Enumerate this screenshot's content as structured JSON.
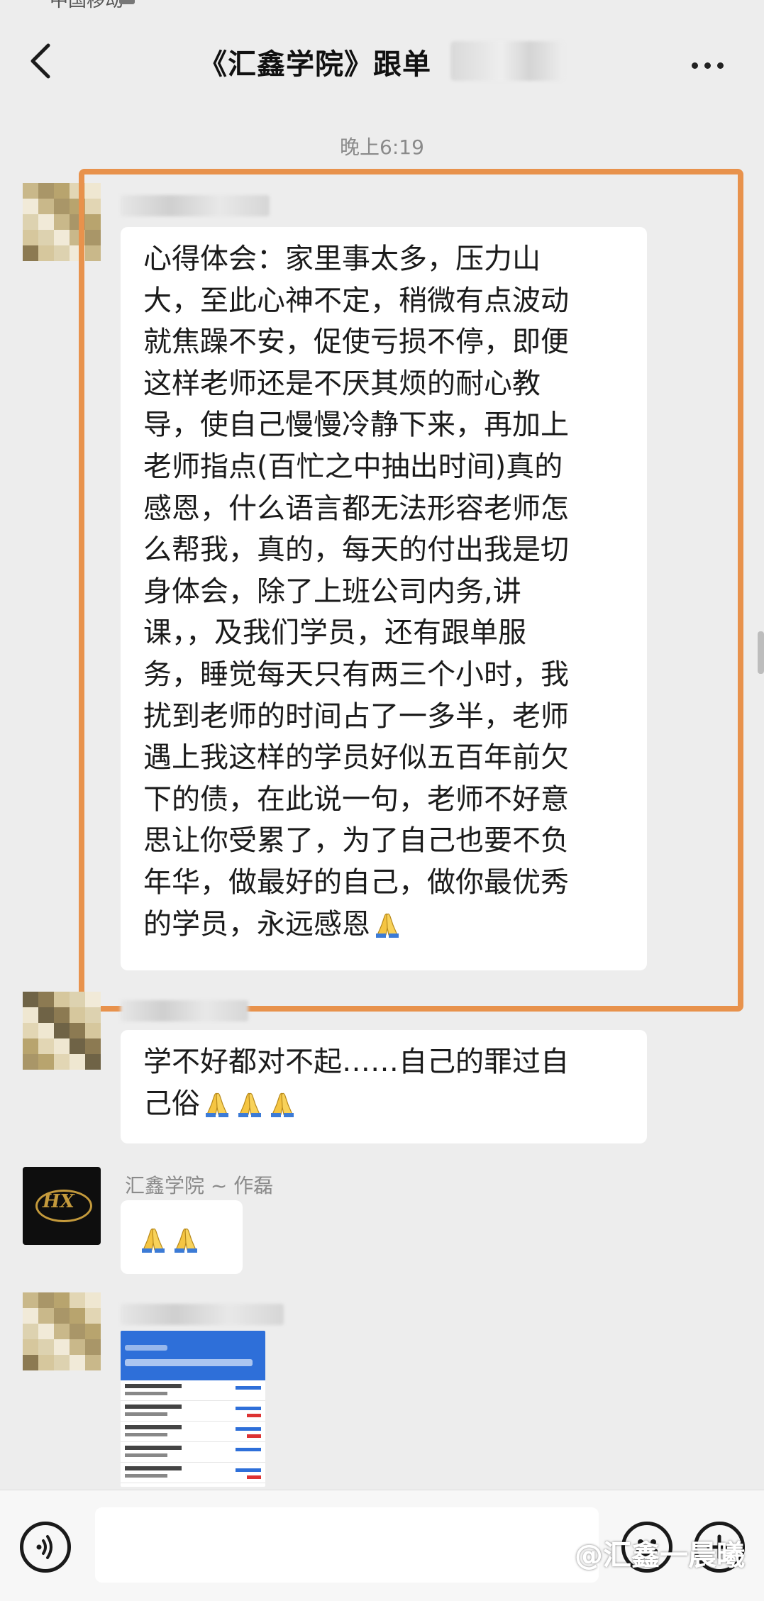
{
  "status": {
    "carrier_text": "中国移动"
  },
  "header": {
    "title": "《汇鑫学院》跟单"
  },
  "timestamp": "晚上6:19",
  "messages": [
    {
      "lines": [
        "心得体会：家里事太多，压力山",
        "大，至此心神不定，稍微有点波动",
        "就焦躁不安，促使亏损不停，即便",
        "这样老师还是不厌其烦的耐心教",
        "导，使自己慢慢冷静下来，再加上",
        "老师指点(百忙之中抽出时间)真的",
        "感恩，什么语言都无法形容老师怎",
        "么帮我，真的，每天的付出我是切",
        "身体会，除了上班公司内务,讲",
        "课，，及我们学员，还有跟单服",
        "务，睡觉每天只有两三个小时，我",
        "扰到老师的时间占了一多半，老师",
        "遇上我这样的学员好似五百年前欠",
        "下的债，在此说一句，老师不好意",
        "思让你受累了，为了自己也要不负",
        "年华，做最好的自己，做你最优秀",
        "的学员，永远感恩"
      ]
    },
    {
      "lines": [
        "学不好都对不起……自己的罪过自",
        "己俗"
      ]
    },
    {
      "sender": "汇鑫学院 ~ 作磊"
    }
  ],
  "watermark": "@汇鑫一晨曦",
  "icons": {
    "back": "chevron-left-icon",
    "more": "more-dots-icon",
    "voice": "voice-icon",
    "emoji": "emoji-icon",
    "plus": "plus-icon",
    "pray": "praying-hands-emoji"
  },
  "colors": {
    "background": "#ededed",
    "bubble": "#ffffff",
    "highlight": "#e8924c",
    "brand_gold": "#c49a3c"
  }
}
